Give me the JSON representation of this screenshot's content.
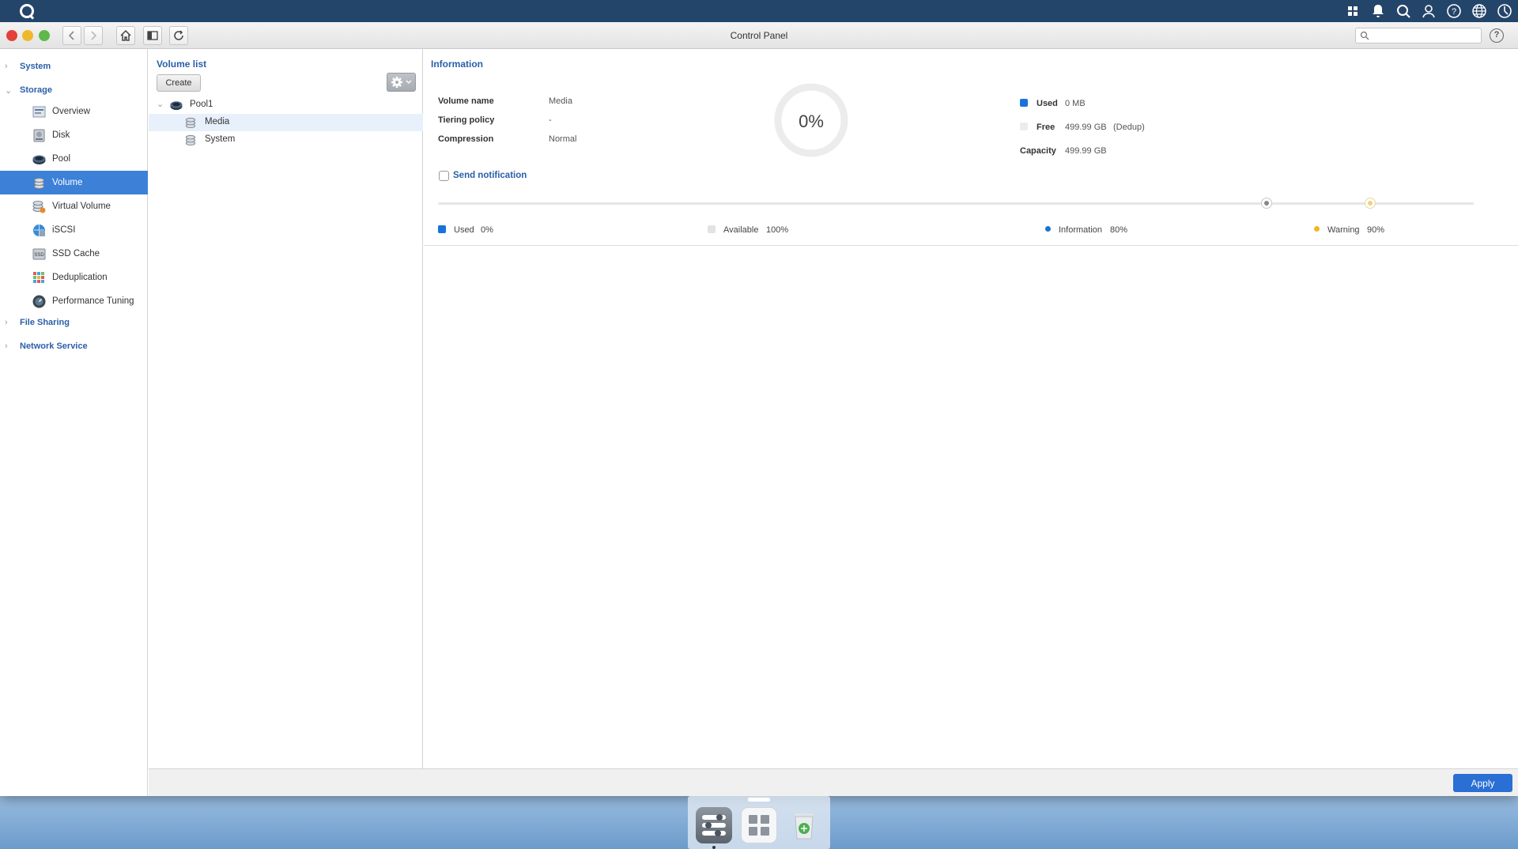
{
  "window": {
    "title": "Control Panel",
    "search_placeholder": ""
  },
  "sidebar": {
    "sections": [
      {
        "label": "System"
      },
      {
        "label": "Storage"
      },
      {
        "label": "File Sharing"
      },
      {
        "label": "Network Service"
      }
    ],
    "storage_items": [
      {
        "label": "Overview",
        "icon": "overview-icon"
      },
      {
        "label": "Disk",
        "icon": "disk-icon"
      },
      {
        "label": "Pool",
        "icon": "pool-icon"
      },
      {
        "label": "Volume",
        "icon": "volume-icon",
        "selected": true
      },
      {
        "label": "Virtual Volume",
        "icon": "virtual-volume-icon"
      },
      {
        "label": "iSCSI",
        "icon": "iscsi-icon"
      },
      {
        "label": "SSD Cache",
        "icon": "ssd-cache-icon"
      },
      {
        "label": "Deduplication",
        "icon": "deduplication-icon"
      },
      {
        "label": "Performance Tuning",
        "icon": "performance-tuning-icon"
      }
    ]
  },
  "volume_list": {
    "title": "Volume list",
    "create_label": "Create",
    "tree": {
      "pool": "Pool1",
      "volumes": [
        "Media",
        "System"
      ],
      "selected": "Media"
    }
  },
  "information": {
    "title": "Information",
    "fields": [
      {
        "label": "Volume name",
        "value": "Media"
      },
      {
        "label": "Tiering policy",
        "value": "-"
      },
      {
        "label": "Compression",
        "value": "Normal"
      }
    ],
    "donut_percent": "0%",
    "usage": {
      "used_label": "Used",
      "used_value": "0 MB",
      "free_label": "Free",
      "free_value": "499.99 GB",
      "free_note": "(Dedup)",
      "capacity_label": "Capacity",
      "capacity_value": "499.99 GB"
    },
    "send_notification_label": "Send notification",
    "threshold_legend": [
      {
        "label": "Used",
        "value": "0%",
        "color": "#1a73d9"
      },
      {
        "label": "Available",
        "value": "100%",
        "color": "#e3e3e3"
      },
      {
        "label": "Information",
        "value": "80%",
        "color": "#1a73d9"
      },
      {
        "label": "Warning",
        "value": "90%",
        "color": "#f3b528"
      }
    ],
    "slider": {
      "information_threshold": 0.8,
      "warning_threshold": 0.9
    }
  },
  "footer": {
    "apply_label": "Apply"
  },
  "colors": {
    "accent": "#3c80d8",
    "link": "#2a5fa8",
    "topbar": "#24456a"
  }
}
